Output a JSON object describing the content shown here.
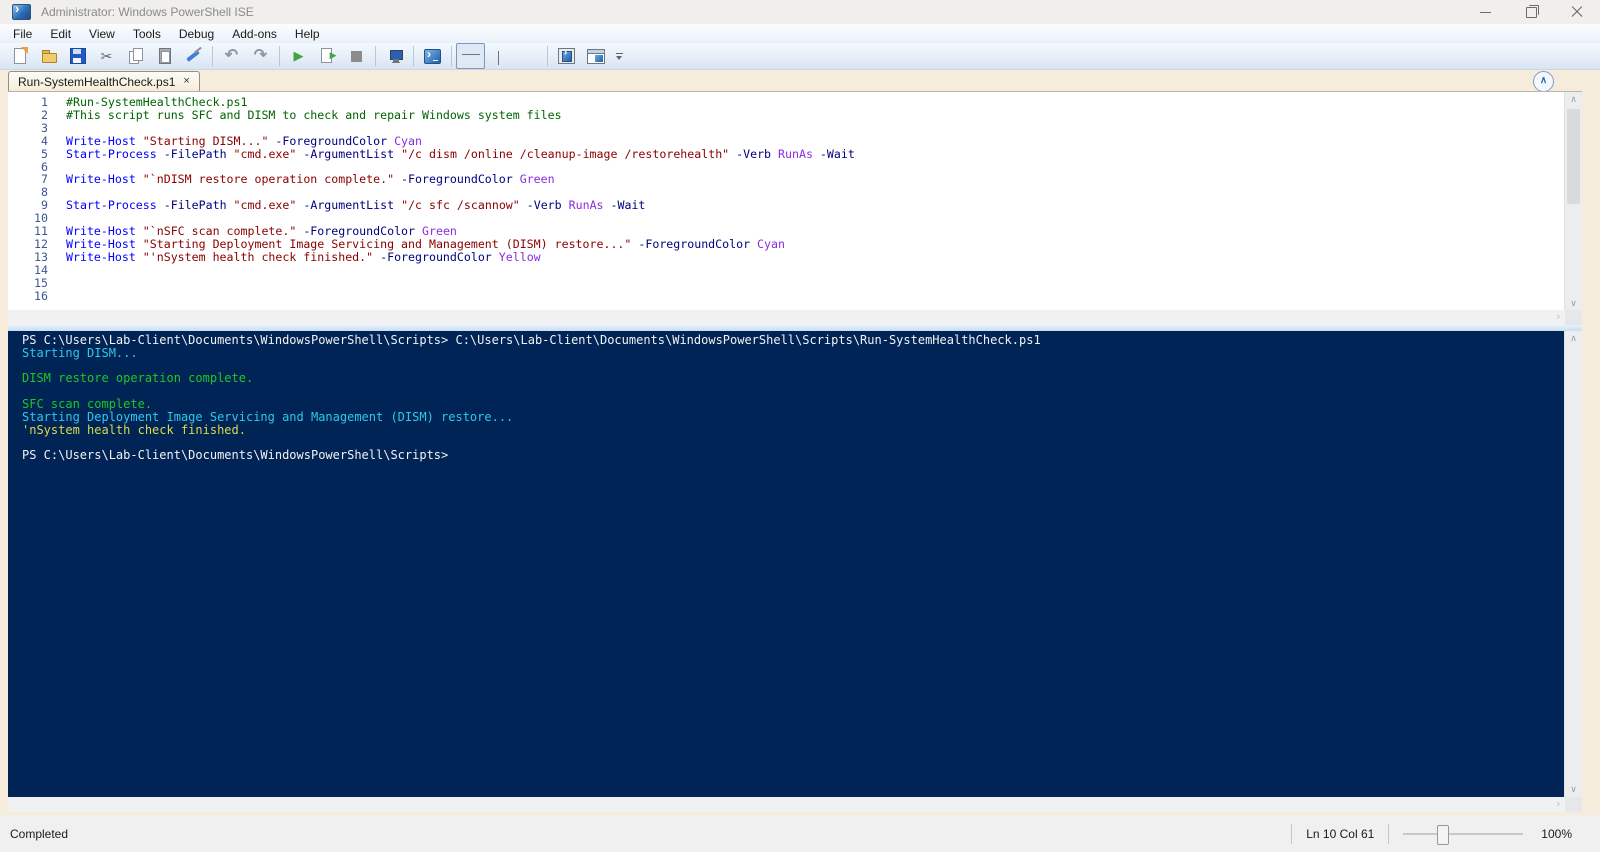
{
  "window": {
    "title": "Administrator: Windows PowerShell ISE"
  },
  "menu": {
    "items": [
      "File",
      "Edit",
      "View",
      "Tools",
      "Debug",
      "Add-ons",
      "Help"
    ]
  },
  "toolbar": {
    "groups": [
      {
        "buttons": [
          {
            "name": "new-script",
            "icon": "new"
          },
          {
            "name": "open-script",
            "icon": "open"
          },
          {
            "name": "save-script",
            "icon": "save"
          },
          {
            "name": "cut",
            "icon": "cut"
          },
          {
            "name": "copy",
            "icon": "copy"
          },
          {
            "name": "paste",
            "icon": "paste"
          },
          {
            "name": "clear-console-pane",
            "icon": "clear"
          }
        ]
      },
      {
        "buttons": [
          {
            "name": "undo",
            "icon": "undo"
          },
          {
            "name": "redo",
            "icon": "redo"
          }
        ]
      },
      {
        "buttons": [
          {
            "name": "run-script",
            "icon": "run"
          },
          {
            "name": "run-selection",
            "icon": "runsel"
          },
          {
            "name": "stop-operation",
            "icon": "stop"
          }
        ]
      },
      {
        "buttons": [
          {
            "name": "new-remote-powershell-tab",
            "icon": "remote"
          }
        ]
      },
      {
        "buttons": [
          {
            "name": "start-powershell-exe",
            "icon": "psexe"
          }
        ]
      },
      {
        "buttons": [
          {
            "name": "show-script-pane-top",
            "icon": "layout-top",
            "selected": true
          },
          {
            "name": "show-script-pane-right",
            "icon": "layout-right"
          },
          {
            "name": "show-script-pane-maximized",
            "icon": "layout-max"
          }
        ]
      },
      {
        "buttons": [
          {
            "name": "new-powershell-tab",
            "icon": "pstab"
          },
          {
            "name": "show-command-window",
            "icon": "pswin"
          }
        ]
      }
    ]
  },
  "icon_glyphs": {
    "cut": "✂",
    "undo": "↶",
    "redo": "↷",
    "run": "▶",
    "chevron-up": "∧",
    "chevron-down": "∨",
    "chevron-right": "›",
    "tab-close": "×"
  },
  "tab": {
    "label": "Run-SystemHealthCheck.ps1"
  },
  "editor": {
    "lines": [
      {
        "n": 1,
        "tokens": [
          [
            "comment",
            "#Run-SystemHealthCheck.ps1"
          ]
        ]
      },
      {
        "n": 2,
        "tokens": [
          [
            "comment",
            "#This script runs SFC and DISM to check and repair Windows system files"
          ]
        ]
      },
      {
        "n": 3,
        "tokens": []
      },
      {
        "n": 4,
        "tokens": [
          [
            "cmdlet",
            "Write-Host "
          ],
          [
            "string",
            "\"Starting DISM...\" "
          ],
          [
            "param",
            "-ForegroundColor "
          ],
          [
            "arg",
            "Cyan"
          ]
        ]
      },
      {
        "n": 5,
        "tokens": [
          [
            "cmdlet",
            "Start-Process "
          ],
          [
            "param",
            "-FilePath "
          ],
          [
            "string",
            "\"cmd.exe\" "
          ],
          [
            "param",
            "-ArgumentList "
          ],
          [
            "string",
            "\"/c dism /online /cleanup-image /restorehealth\" "
          ],
          [
            "param",
            "-Verb "
          ],
          [
            "arg",
            "RunAs "
          ],
          [
            "param",
            "-Wait"
          ]
        ]
      },
      {
        "n": 6,
        "tokens": []
      },
      {
        "n": 7,
        "tokens": [
          [
            "cmdlet",
            "Write-Host "
          ],
          [
            "string",
            "\"`nDISM restore operation complete.\" "
          ],
          [
            "param",
            "-ForegroundColor "
          ],
          [
            "arg",
            "Green"
          ]
        ]
      },
      {
        "n": 8,
        "tokens": []
      },
      {
        "n": 9,
        "tokens": [
          [
            "cmdlet",
            "Start-Process "
          ],
          [
            "param",
            "-FilePath "
          ],
          [
            "string",
            "\"cmd.exe\" "
          ],
          [
            "param",
            "-ArgumentList "
          ],
          [
            "string",
            "\"/c sfc /scannow\" "
          ],
          [
            "param",
            "-Verb "
          ],
          [
            "arg",
            "RunAs "
          ],
          [
            "param",
            "-Wait"
          ]
        ]
      },
      {
        "n": 10,
        "tokens": []
      },
      {
        "n": 11,
        "tokens": [
          [
            "cmdlet",
            "Write-Host "
          ],
          [
            "string",
            "\"`nSFC scan complete.\" "
          ],
          [
            "param",
            "-ForegroundColor "
          ],
          [
            "arg",
            "Green"
          ]
        ]
      },
      {
        "n": 12,
        "tokens": [
          [
            "cmdlet",
            "Write-Host "
          ],
          [
            "string",
            "\"Starting Deployment Image Servicing and Management (DISM) restore...\" "
          ],
          [
            "param",
            "-ForegroundColor "
          ],
          [
            "arg",
            "Cyan"
          ]
        ]
      },
      {
        "n": 13,
        "tokens": [
          [
            "cmdlet",
            "Write-Host "
          ],
          [
            "string",
            "\"'nSystem health check finished.\" "
          ],
          [
            "param",
            "-ForegroundColor "
          ],
          [
            "arg",
            "Yellow"
          ]
        ]
      },
      {
        "n": 14,
        "tokens": []
      },
      {
        "n": 15,
        "tokens": []
      },
      {
        "n": 16,
        "tokens": []
      }
    ]
  },
  "console": {
    "lines": [
      [
        "plain",
        "PS C:\\Users\\Lab-Client\\Documents\\WindowsPowerShell\\Scripts> C:\\Users\\Lab-Client\\Documents\\WindowsPowerShell\\Scripts\\Run-SystemHealthCheck.ps1"
      ],
      [
        "cyan",
        "Starting DISM..."
      ],
      [
        "blank",
        ""
      ],
      [
        "green",
        "DISM restore operation complete."
      ],
      [
        "blank",
        ""
      ],
      [
        "green",
        "SFC scan complete."
      ],
      [
        "cyan",
        "Starting Deployment Image Servicing and Management (DISM) restore..."
      ],
      [
        "yellow",
        "'nSystem health check finished."
      ],
      [
        "blank",
        ""
      ],
      [
        "plain",
        "PS C:\\Users\\Lab-Client\\Documents\\WindowsPowerShell\\Scripts>"
      ]
    ]
  },
  "statusbar": {
    "status": "Completed",
    "cursor": "Ln 10  Col 61",
    "zoom_label": "100%"
  },
  "colors": {
    "console_bg": "#012456",
    "console_cyan": "#2ec9e8",
    "console_green": "#1dc823",
    "console_yellow": "#d9d94a",
    "syntax_cmdlet": "#0000ff",
    "syntax_parameter": "#000080",
    "syntax_string": "#8b0000",
    "syntax_comment": "#006400",
    "syntax_argument": "#8a2be2",
    "window_background": "#f6ecdc"
  }
}
